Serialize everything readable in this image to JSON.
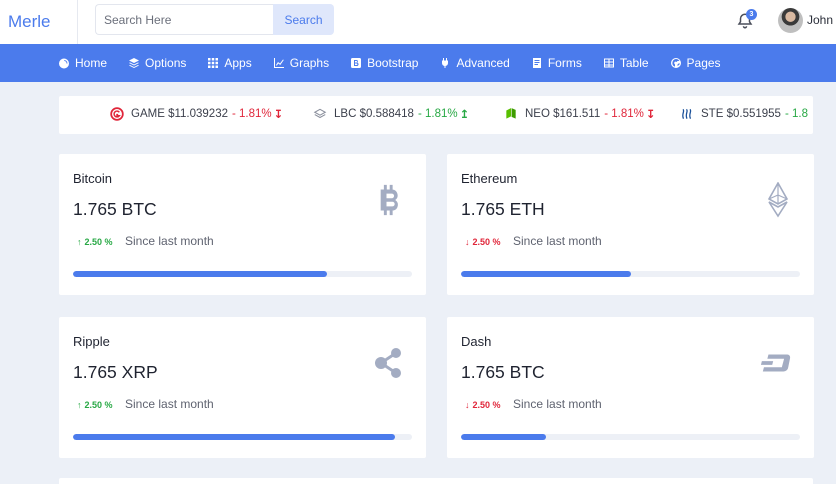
{
  "header": {
    "brand": "Merle",
    "search": {
      "placeholder": "Search Here",
      "button_label": "Search"
    },
    "notifications": {
      "count": "3"
    },
    "user": {
      "name": "John"
    }
  },
  "nav": {
    "items": [
      {
        "label": "Home",
        "icon": "gauge-icon"
      },
      {
        "label": "Options",
        "icon": "layers-icon"
      },
      {
        "label": "Apps",
        "icon": "grid-icon"
      },
      {
        "label": "Graphs",
        "icon": "chart-icon"
      },
      {
        "label": "Bootstrap",
        "icon": "bootstrap-icon"
      },
      {
        "label": "Advanced",
        "icon": "plug-icon"
      },
      {
        "label": "Forms",
        "icon": "form-icon"
      },
      {
        "label": "Table",
        "icon": "table-icon"
      },
      {
        "label": "Pages",
        "icon": "globe-icon"
      }
    ]
  },
  "ticker": [
    {
      "symbol": "GAME",
      "price": "$11.039232",
      "change": "- 1.81%",
      "direction": "down",
      "color": "#e0263a"
    },
    {
      "symbol": "LBC",
      "price": "$0.588418",
      "change": "- 1.81%",
      "direction": "up",
      "color": "#27a844"
    },
    {
      "symbol": "NEO",
      "price": "$161.511",
      "change": "- 1.81%",
      "direction": "down",
      "color": "#e0263a"
    },
    {
      "symbol": "STE",
      "price": "$0.551955",
      "change": "- 1.8",
      "direction": "up",
      "color": "#27a844"
    }
  ],
  "cards": [
    {
      "name": "Bitcoin",
      "amount": "1.765 BTC",
      "percent": "2.50 %",
      "direction": "up",
      "since": "Since last month",
      "progress": 0.75,
      "icon": "bitcoin-icon"
    },
    {
      "name": "Ethereum",
      "amount": "1.765 ETH",
      "percent": "2.50 %",
      "direction": "down",
      "since": "Since last month",
      "progress": 0.5,
      "icon": "ethereum-icon"
    },
    {
      "name": "Ripple",
      "amount": "1.765 XRP",
      "percent": "2.50 %",
      "direction": "up",
      "since": "Since last month",
      "progress": 0.95,
      "icon": "ripple-icon"
    },
    {
      "name": "Dash",
      "amount": "1.765 BTC",
      "percent": "2.50 %",
      "direction": "down",
      "since": "Since last month",
      "progress": 0.25,
      "icon": "dash-icon"
    }
  ],
  "colors": {
    "accent": "#4b7bec",
    "up": "#27a844",
    "down": "#e0263a",
    "icon_muted": "#a3acc2"
  }
}
